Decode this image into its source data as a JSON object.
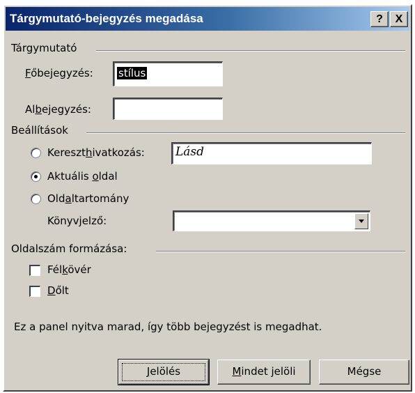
{
  "window": {
    "title": "Tárgymutató-bejegyzés megadása",
    "help_label": "?",
    "close_label": "X"
  },
  "index": {
    "heading": "Tárgymutató",
    "main_entry_label": {
      "pre": "",
      "u": "F",
      "post": "őbejegyzés:"
    },
    "main_entry_value": "stílus",
    "subentry_label": {
      "pre": "Al",
      "u": "b",
      "post": "ejegyzés:"
    },
    "subentry_value": ""
  },
  "options": {
    "heading": "Beállítások",
    "cross_ref": {
      "pre": "Kereszt",
      "u": "h",
      "post": "ivatkozás:",
      "selected": false,
      "value": "Lásd"
    },
    "current_page": {
      "pre": "Aktuális ",
      "u": "o",
      "post": "ldal",
      "selected": true
    },
    "page_range": {
      "pre": "Old",
      "u": "a",
      "post": "ltartomány",
      "selected": false
    },
    "bookmark_label": "Könyvjelző:",
    "bookmark_value": ""
  },
  "format": {
    "heading": "Oldalszám formázása:",
    "bold": {
      "pre": "Fél",
      "u": "k",
      "post": "övér",
      "checked": false
    },
    "italic": {
      "pre": "",
      "u": "D",
      "post": "őlt",
      "checked": false
    }
  },
  "note": "Ez a panel nyitva marad, így több bejegyzést is megadhat.",
  "buttons": {
    "mark": {
      "pre": "",
      "u": "J",
      "post": "elölés"
    },
    "mark_all": {
      "pre": "",
      "u": "M",
      "post": "indet jelöli"
    },
    "cancel": {
      "pre": "",
      "u": "",
      "post": "Mégse"
    }
  }
}
